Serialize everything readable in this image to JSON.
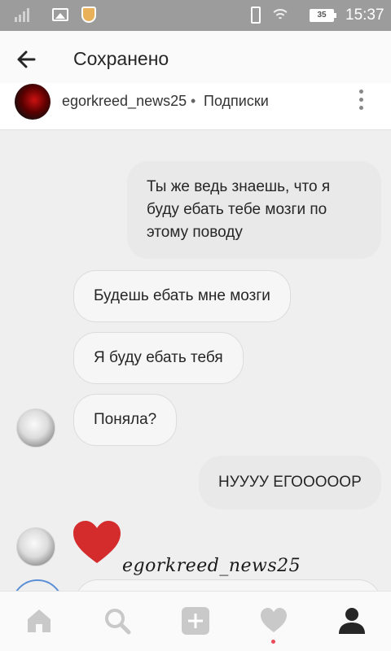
{
  "status_bar": {
    "battery_level": "35",
    "time": "15:37"
  },
  "header": {
    "title": "Сохранено"
  },
  "post": {
    "username": "egorkreed_news25",
    "separator": "•",
    "following_label": "Подписки"
  },
  "messages": [
    {
      "side": "outgoing",
      "text": "Ты же ведь знаешь, что я буду ебать тебе мозги по этому поводу"
    },
    {
      "side": "incoming",
      "text": "Будешь ебать мне мозги"
    },
    {
      "side": "incoming",
      "text": "Я буду ебать тебя"
    },
    {
      "side": "incoming",
      "text": "Поняла?"
    },
    {
      "side": "outgoing",
      "text": "НУУУУ ЕГОООООР"
    },
    {
      "side": "incoming",
      "text": "",
      "sticker": "heart-icon"
    }
  ],
  "watermark": "egorkreed_news25",
  "bottom_nav": [
    "home-icon",
    "search-icon",
    "add-icon",
    "heart-icon",
    "profile-icon"
  ],
  "colors": {
    "heart": "#d42c2c",
    "notification_dot": "#ed4956",
    "status_bar": "#9c9c9c"
  }
}
